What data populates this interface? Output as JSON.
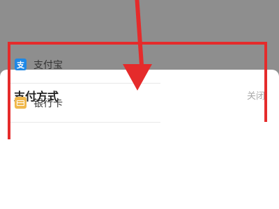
{
  "payment_sheet": {
    "title": "支付方式",
    "close_label": "关闭",
    "methods": [
      {
        "label": "支付宝",
        "icon": "alipay-icon",
        "icon_glyph": "支"
      },
      {
        "label": "银行卡",
        "icon": "bank-card-icon"
      }
    ]
  },
  "colors": {
    "overlay": "#8e8e8e",
    "highlight": "#e52b2b",
    "alipay": "#1e88e5",
    "bank_card": "#f0b84c"
  }
}
